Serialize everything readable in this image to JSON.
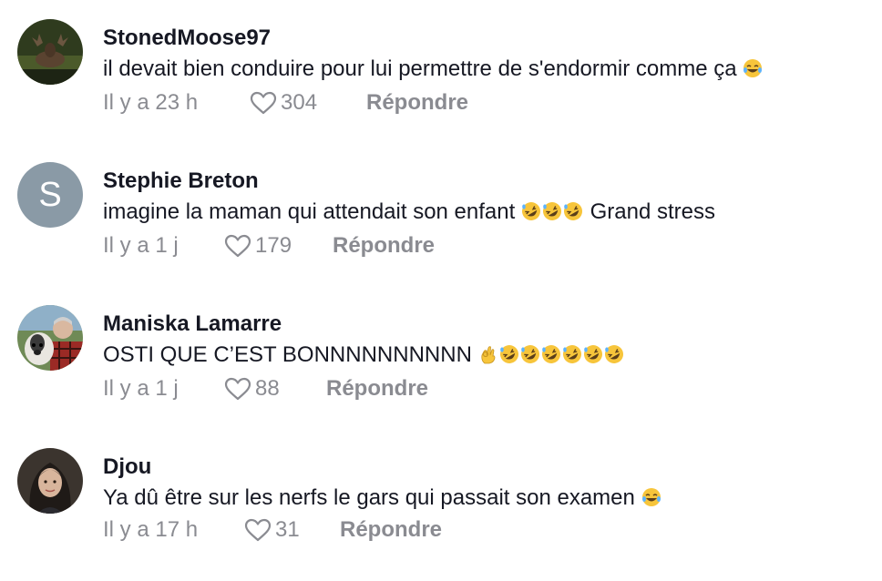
{
  "comments": [
    {
      "username": "StonedMoose97",
      "text": "il devait bien conduire pour lui permettre de s'endormir comme ça",
      "emojis": [
        "face-with-tears-of-joy"
      ],
      "time": "Il y a 23 h",
      "likes": "304",
      "reply_label": "Répondre"
    },
    {
      "username": "Stephie Breton",
      "avatar_letter": "S",
      "text_before": "imagine la maman qui attendait son enfant",
      "emojis": [
        "rolling-on-floor-laughing",
        "rolling-on-floor-laughing",
        "rolling-on-floor-laughing"
      ],
      "text_after": "Grand stress",
      "time": "Il y a 1 j",
      "likes": "179",
      "reply_label": "Répondre"
    },
    {
      "username": "Maniska Lamarre",
      "text": "OSTI QUE C’EST BONNNNNNNNNN",
      "emojis": [
        "ok-hand",
        "rolling-on-floor-laughing",
        "rolling-on-floor-laughing",
        "rolling-on-floor-laughing",
        "rolling-on-floor-laughing",
        "rolling-on-floor-laughing",
        "rolling-on-floor-laughing"
      ],
      "time": "Il y a 1 j",
      "likes": "88",
      "reply_label": "Répondre"
    },
    {
      "username": "Djou",
      "text": "Ya dû être sur les nerfs le gars qui passait son examen",
      "emojis": [
        "face-with-tears-of-joy"
      ],
      "time": "Il y a 17 h",
      "likes": "31",
      "reply_label": "Répondre"
    }
  ],
  "colors": {
    "text": "#161823",
    "meta": "#8a8b91",
    "avatar_letter_bg": "#8a9aa6",
    "emoji_yellow": "#f7c53b"
  }
}
